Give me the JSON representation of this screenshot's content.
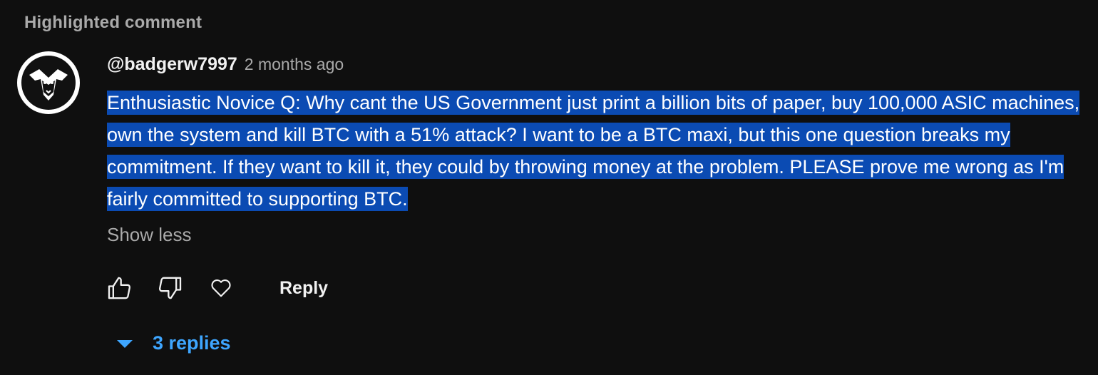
{
  "section": {
    "label": "Highlighted comment"
  },
  "comment": {
    "author": "@badgerw7997",
    "timestamp": "2 months ago",
    "text": "Enthusiastic Novice Q:  Why cant the US Government just print a billion bits of paper, buy 100,000 ASIC machines, own the system and kill BTC with a 51% attack?  I want to be a BTC maxi, but this one question breaks my commitment.  If they want to kill it, they could by throwing money at the problem.  PLEASE prove me wrong as I'm fairly committed to supporting BTC.",
    "show_less_label": "Show less"
  },
  "actions": {
    "like_icon": "thumbs-up-icon",
    "dislike_icon": "thumbs-down-icon",
    "heart_icon": "heart-icon",
    "reply_label": "Reply"
  },
  "replies": {
    "label": "3 replies",
    "icon": "caret-down-icon",
    "color": "#3ea6ff"
  },
  "colors": {
    "background": "#0f0f0f",
    "highlight": "#0b4bb3",
    "secondary_text": "#aaaaaa"
  }
}
